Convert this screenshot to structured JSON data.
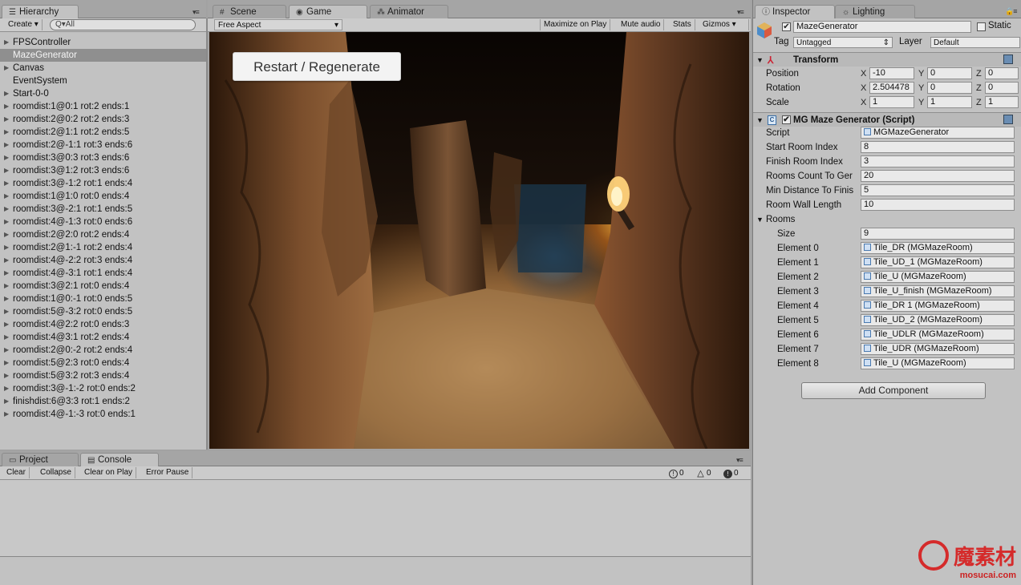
{
  "hierarchy": {
    "tab_label": "Hierarchy",
    "create_label": "Create",
    "search_placeholder": "Q▾All",
    "items": [
      {
        "label": "FPSController",
        "expandable": true
      },
      {
        "label": "MazeGenerator",
        "expandable": false,
        "selected": true
      },
      {
        "label": "Canvas",
        "expandable": true
      },
      {
        "label": "EventSystem",
        "expandable": false
      },
      {
        "label": "Start-0-0",
        "expandable": true
      },
      {
        "label": "roomdist:1@0:1 rot:2 ends:1",
        "expandable": true
      },
      {
        "label": "roomdist:2@0:2 rot:2 ends:3",
        "expandable": true
      },
      {
        "label": "roomdist:2@1:1 rot:2 ends:5",
        "expandable": true
      },
      {
        "label": "roomdist:2@-1:1 rot:3 ends:6",
        "expandable": true
      },
      {
        "label": "roomdist:3@0:3 rot:3 ends:6",
        "expandable": true
      },
      {
        "label": "roomdist:3@1:2 rot:3 ends:6",
        "expandable": true
      },
      {
        "label": "roomdist:3@-1:2 rot:1 ends:4",
        "expandable": true
      },
      {
        "label": "roomdist:1@1:0 rot:0 ends:4",
        "expandable": true
      },
      {
        "label": "roomdist:3@-2:1 rot:1 ends:5",
        "expandable": true
      },
      {
        "label": "roomdist:4@-1:3 rot:0 ends:6",
        "expandable": true
      },
      {
        "label": "roomdist:2@2:0 rot:2 ends:4",
        "expandable": true
      },
      {
        "label": "roomdist:2@1:-1 rot:2 ends:4",
        "expandable": true
      },
      {
        "label": "roomdist:4@-2:2 rot:3 ends:4",
        "expandable": true
      },
      {
        "label": "roomdist:4@-3:1 rot:1 ends:4",
        "expandable": true
      },
      {
        "label": "roomdist:3@2:1 rot:0 ends:4",
        "expandable": true
      },
      {
        "label": "roomdist:1@0:-1 rot:0 ends:5",
        "expandable": true
      },
      {
        "label": "roomdist:5@-3:2 rot:0 ends:5",
        "expandable": true
      },
      {
        "label": "roomdist:4@2:2 rot:0 ends:3",
        "expandable": true
      },
      {
        "label": "roomdist:4@3:1 rot:2 ends:4",
        "expandable": true
      },
      {
        "label": "roomdist:2@0:-2 rot:2 ends:4",
        "expandable": true
      },
      {
        "label": "roomdist:5@2:3 rot:0 ends:4",
        "expandable": true
      },
      {
        "label": "roomdist:5@3:2 rot:3 ends:4",
        "expandable": true
      },
      {
        "label": "roomdist:3@-1:-2 rot:0 ends:2",
        "expandable": true
      },
      {
        "label": "finishdist:6@3:3 rot:1 ends:2",
        "expandable": true
      },
      {
        "label": "roomdist:4@-1:-3 rot:0 ends:1",
        "expandable": true
      }
    ]
  },
  "center_tabs": {
    "scene": "Scene",
    "game": "Game",
    "animator": "Animator"
  },
  "game": {
    "aspect": "Free Aspect",
    "toolbar": [
      "Maximize on Play",
      "Mute audio",
      "Stats",
      "Gizmos"
    ],
    "restart_button": "Restart / Regenerate"
  },
  "inspector": {
    "tab_label": "Inspector",
    "lighting_tab": "Lighting",
    "object_name": "MazeGenerator",
    "static_label": "Static",
    "tag_label": "Tag",
    "tag_value": "Untagged",
    "layer_label": "Layer",
    "layer_value": "Default",
    "transform": {
      "title": "Transform",
      "position_label": "Position",
      "rotation_label": "Rotation",
      "scale_label": "Scale",
      "position": [
        "-10",
        "0",
        "0"
      ],
      "rotation": [
        "2.504478",
        "0",
        "0"
      ],
      "scale": [
        "1",
        "1",
        "1"
      ]
    },
    "axes": [
      "X",
      "Y",
      "Z"
    ],
    "script_component": {
      "title": "MG Maze Generator (Script)",
      "fields": [
        {
          "label": "Script",
          "value": "MGMazeGenerator",
          "object": true
        },
        {
          "label": "Start Room Index",
          "value": "8"
        },
        {
          "label": "Finish Room Index",
          "value": "3"
        },
        {
          "label": "Rooms Count To Ger",
          "value": "20"
        },
        {
          "label": "Min Distance To Finis",
          "value": "5"
        },
        {
          "label": "Room Wall Length",
          "value": "10"
        }
      ],
      "rooms_label": "Rooms",
      "size_label": "Size",
      "size_value": "9",
      "elements": [
        {
          "label": "Element 0",
          "value": "Tile_DR (MGMazeRoom)"
        },
        {
          "label": "Element 1",
          "value": "Tile_UD_1 (MGMazeRoom)"
        },
        {
          "label": "Element 2",
          "value": "Tile_U (MGMazeRoom)"
        },
        {
          "label": "Element 3",
          "value": "Tile_U_finish (MGMazeRoom)"
        },
        {
          "label": "Element 4",
          "value": "Tile_DR 1 (MGMazeRoom)"
        },
        {
          "label": "Element 5",
          "value": "Tile_UD_2 (MGMazeRoom)"
        },
        {
          "label": "Element 6",
          "value": "Tile_UDLR (MGMazeRoom)"
        },
        {
          "label": "Element 7",
          "value": "Tile_UDR (MGMazeRoom)"
        },
        {
          "label": "Element 8",
          "value": "Tile_U (MGMazeRoom)"
        }
      ]
    },
    "add_component": "Add Component"
  },
  "console": {
    "project_tab": "Project",
    "console_tab": "Console",
    "buttons": [
      "Clear",
      "Collapse",
      "Clear on Play",
      "Error Pause"
    ],
    "counts": {
      "info": "0",
      "warnings": "0",
      "errors": "0"
    }
  },
  "watermark": {
    "text": "魔素材",
    "url": "mosucai.com"
  },
  "colors": {
    "selection": "#8f8f8f",
    "panel": "#c2c2c2",
    "restart_bg": "#f3f3f3"
  }
}
